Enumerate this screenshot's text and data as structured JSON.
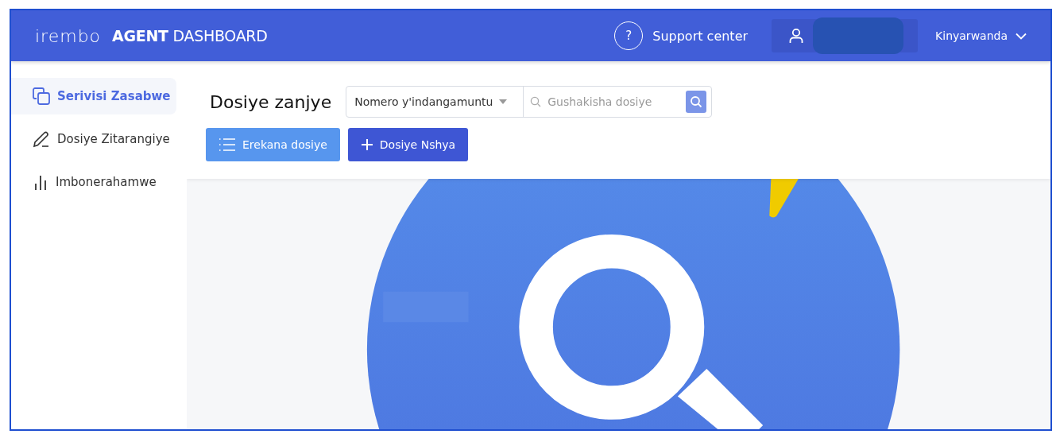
{
  "header": {
    "logo": "irembo",
    "title_bold": "AGENT",
    "title_rest": "DASHBOARD",
    "support": {
      "icon_text": "?",
      "label": "Support center"
    },
    "language": "Kinyarwanda"
  },
  "sidebar": {
    "items": [
      {
        "label": "Serivisi Zasabwe",
        "selected": true
      },
      {
        "label": "Dosiye Zitarangiye",
        "selected": false
      },
      {
        "label": "Imbonerahamwe",
        "selected": false
      }
    ]
  },
  "main": {
    "title": "Dosiye zanjye",
    "search": {
      "filter": "Nomero y'indangamuntu",
      "placeholder": "Gushakisha dosiye"
    },
    "buttons": [
      {
        "label": "Erekana dosiye",
        "kind": "secondary"
      },
      {
        "label": "Dosiye Nshya",
        "kind": "primary"
      }
    ]
  }
}
